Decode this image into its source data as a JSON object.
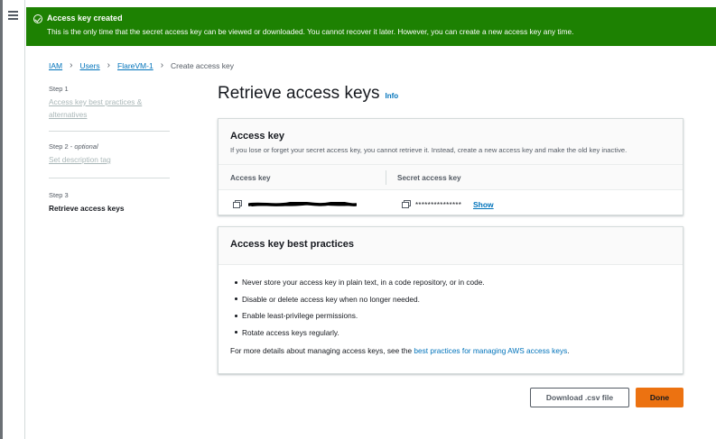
{
  "flash": {
    "title": "Access key created",
    "message": "This is the only time that the secret access key can be viewed or downloaded. You cannot recover it later. However, you can create a new access key any time.",
    "color": "#1d8102"
  },
  "breadcrumb": {
    "items": [
      "IAM",
      "Users",
      "FlareVM-1"
    ],
    "current": "Create access key"
  },
  "steps": [
    {
      "number": "Step 1",
      "label": "Access key best practices & alternatives"
    },
    {
      "number": "Step 2",
      "optional": "optional",
      "label": "Set description tag"
    },
    {
      "number": "Step 3",
      "label": "Retrieve access keys"
    }
  ],
  "page": {
    "title": "Retrieve access keys",
    "info": "Info"
  },
  "access_key_panel": {
    "title": "Access key",
    "description": "If you lose or forget your secret access key, you cannot retrieve it. Instead, create a new access key and make the old key inactive.",
    "columns": [
      "Access key",
      "Secret access key"
    ],
    "secret_masked": "***************",
    "show_label": "Show"
  },
  "best_practices_panel": {
    "title": "Access key best practices",
    "items": [
      "Never store your access key in plain text, in a code repository, or in code.",
      "Disable or delete access key when no longer needed.",
      "Enable least-privilege permissions.",
      "Rotate access keys regularly."
    ],
    "more_prefix": "For more details about managing access keys, see the ",
    "more_link": "best practices for managing AWS access keys",
    "more_suffix": "."
  },
  "buttons": {
    "download": "Download .csv file",
    "done": "Done"
  },
  "colors": {
    "link": "#0073bb",
    "primary": "#ec7211"
  }
}
